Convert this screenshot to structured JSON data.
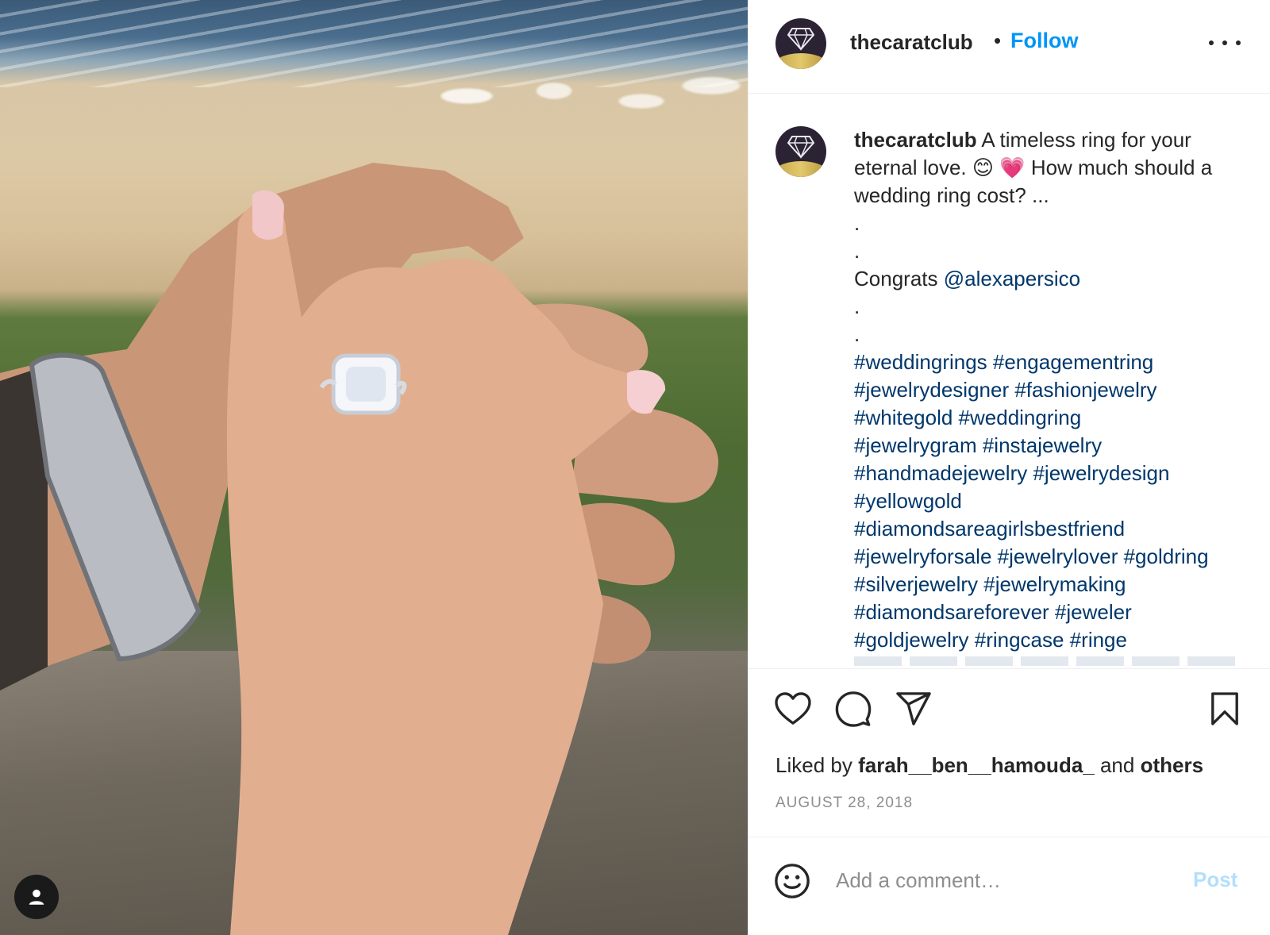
{
  "header": {
    "username": "thecaratclub",
    "separator": "•",
    "follow_label": "Follow",
    "more_icon": "more-horizontal-icon"
  },
  "caption": {
    "username": "thecaratclub",
    "text_1": "A timeless ring for your eternal love. ",
    "emoji_1": "😊",
    "emoji_2": "💗",
    "text_2": " How much should a wedding ring cost? ...",
    "dot_1": ".",
    "dot_2": ".",
    "congrats": "Congrats ",
    "mention": "@alexapersico",
    "dot_3": ".",
    "dot_4": ".",
    "hashtags": [
      "#weddingrings #engagementring",
      "#jewelrydesigner #fashionjewelry",
      "#whitegold #weddingring",
      "#jewelrygram #instajewelry",
      "#handmadejewelry #jewelrydesign",
      "#yellowgold",
      "#diamondsareagirlsbestfriend",
      "#jewelryforsale #jewelrylover #goldring",
      "#silverjewelry #jewelrymaking",
      "#diamondsareforever #jeweler",
      "#goldjewelry #ringcase #ringe"
    ]
  },
  "actions": {
    "like_icon": "heart-icon",
    "comment_icon": "comment-icon",
    "share_icon": "paper-plane-icon",
    "save_icon": "bookmark-icon"
  },
  "likes": {
    "prefix": "Liked by ",
    "user": "farah__ben__hamouda_",
    "middle": " and ",
    "others": "others"
  },
  "date": "AUGUST 28, 2018",
  "comment": {
    "emoji_icon": "smiley-icon",
    "placeholder": "Add a comment…",
    "post_label": "Post"
  },
  "photo": {
    "tag_icon": "user-tag-icon"
  },
  "colors": {
    "link": "#0095f6",
    "hashtag": "#00376b",
    "muted": "#8e8e8e",
    "post_disabled": "#b2dffc"
  }
}
